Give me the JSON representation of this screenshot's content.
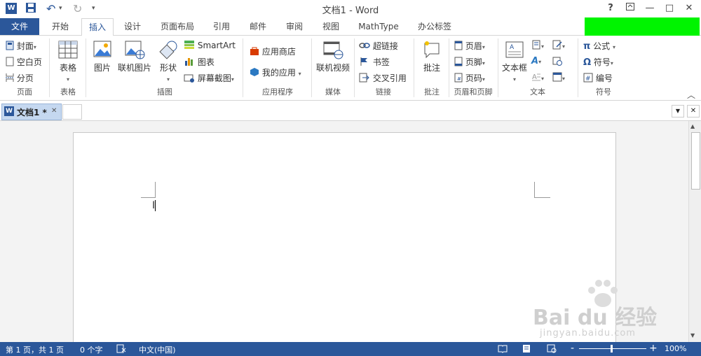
{
  "window": {
    "title": "文档1 - Word",
    "help": "?",
    "minimize": "—",
    "maximize": "□",
    "close": "✕"
  },
  "quick_access": {
    "undo_caret": "▾",
    "customize": "▾"
  },
  "tabs": [
    "文件",
    "开始",
    "插入",
    "设计",
    "页面布局",
    "引用",
    "邮件",
    "审阅",
    "视图",
    "MathType",
    "办公标签"
  ],
  "active_tab": "插入",
  "ribbon": {
    "page_group": {
      "label": "页面",
      "cover": "封面",
      "blank": "空白页",
      "break": "分页"
    },
    "table_group": {
      "label": "表格",
      "table": "表格"
    },
    "illustration_group": {
      "label": "插图",
      "picture": "图片",
      "online_picture": "联机图片",
      "shapes": "形状",
      "smartart": "SmartArt",
      "chart": "图表",
      "screenshot": "屏幕截图"
    },
    "apps_group": {
      "label": "应用程序",
      "store": "应用商店",
      "my_apps": "我的应用"
    },
    "media_group": {
      "label": "媒体",
      "online_video": "联机视频"
    },
    "links_group": {
      "label": "链接",
      "hyperlink": "超链接",
      "bookmark": "书签",
      "cross_ref": "交叉引用"
    },
    "comments_group": {
      "label": "批注",
      "comment": "批注"
    },
    "header_footer_group": {
      "label": "页眉和页脚",
      "header": "页眉",
      "footer": "页脚",
      "page_number": "页码"
    },
    "text_group": {
      "label": "文本",
      "textbox": "文本框"
    },
    "symbols_group": {
      "label": "符号",
      "equation": "公式",
      "symbol": "符号",
      "number": "编号"
    }
  },
  "doc_tabs": {
    "tab1": "文档1 *",
    "close": "✕"
  },
  "statusbar": {
    "page": "第 1 页，共 1 页",
    "words": "0 个字",
    "language": "中文(中国)",
    "zoom": "100%",
    "zoom_minus": "-",
    "zoom_plus": "+"
  },
  "watermark": {
    "brand": "Bai du 经验",
    "url": "jingyan.baidu.com"
  },
  "colors": {
    "accent": "#2b579a",
    "green_box": "#00f400"
  }
}
